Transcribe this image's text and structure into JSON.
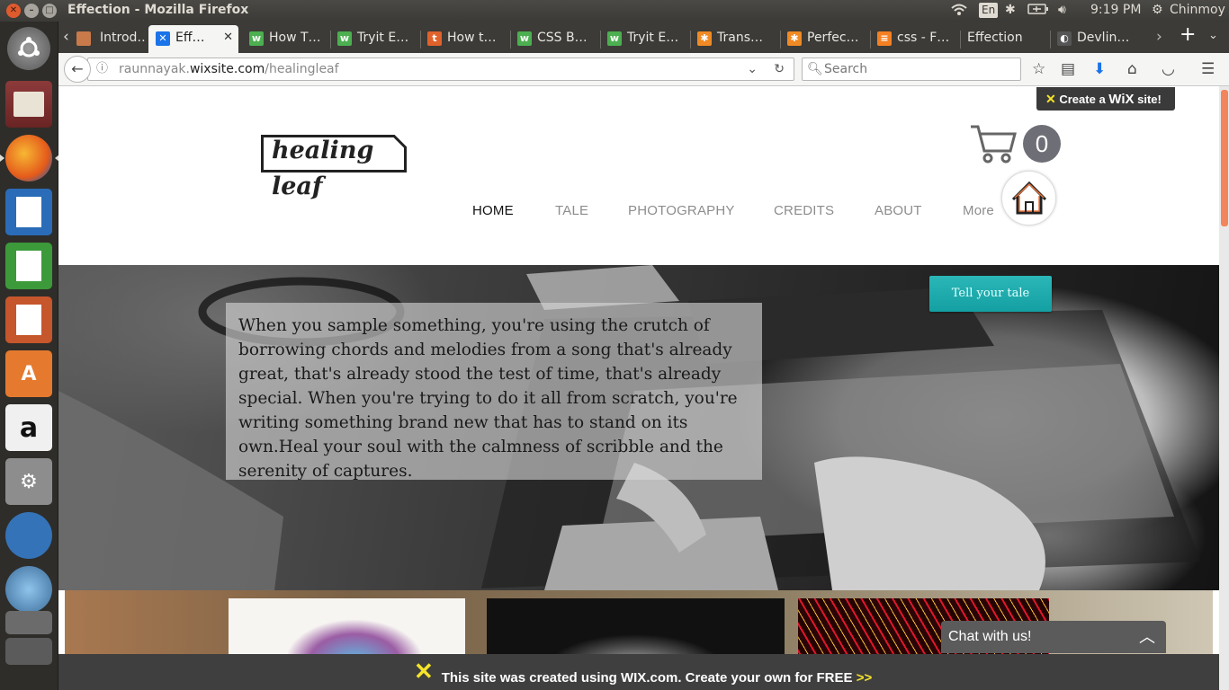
{
  "os": {
    "window_title": "Effection - Mozilla Firefox",
    "tray": {
      "keyboard": "En",
      "time": "9:19 PM",
      "user": "Chinmoy"
    }
  },
  "launcher": {
    "items": [
      "ubuntu-dash",
      "files",
      "firefox",
      "writer",
      "calc",
      "impress",
      "software-center",
      "amazon",
      "system-settings",
      "app-fish",
      "app-spiral",
      "workspaces",
      "trash"
    ]
  },
  "browser": {
    "tabs": [
      {
        "label": "Introd…",
        "icon": "doc"
      },
      {
        "label": "Eff…",
        "icon": "wix",
        "active": true
      },
      {
        "label": "How T…",
        "icon": "w3"
      },
      {
        "label": "Tryit E…",
        "icon": "w3"
      },
      {
        "label": "How t…",
        "icon": "t"
      },
      {
        "label": "CSS B…",
        "icon": "w3"
      },
      {
        "label": "Tryit E…",
        "icon": "w3"
      },
      {
        "label": "Trans…",
        "icon": "star"
      },
      {
        "label": "Perfec…",
        "icon": "star"
      },
      {
        "label": "css - F…",
        "icon": "so"
      },
      {
        "label": "Effection",
        "icon": "none"
      },
      {
        "label": "Devlin…",
        "icon": "dev"
      }
    ],
    "url_domain_prefix": "raunnayak.",
    "url_domain": "wixsite.com",
    "url_path": "/healingleaf",
    "search_placeholder": "Search"
  },
  "site": {
    "logo_line1": "healing",
    "logo_line2": "leaf",
    "cart_count": "0",
    "menu": [
      "HOME",
      "TALE",
      "PHOTOGRAPHY",
      "CREDITS",
      "ABOUT",
      "More"
    ],
    "active_menu": "HOME",
    "quote": "When you sample something, you're using the crutch of borrowing chords and melodies from a song that's already great, that's already stood the test of time, that's already special. When you're trying to do it all from scratch, you're writing something brand new that has to stand on its own.Heal your soul with the calmness of scribble and the serenity of captures.",
    "tale_button": "Tell your tale",
    "wix_badge_pre": "Create a",
    "wix_badge_brand": "WiX",
    "wix_badge_post": "site!",
    "chat_label": "Chat with us!",
    "wix_bar_text": "This site was created using WIX.com. Create your own for FREE",
    "wix_bar_arrow": ">>"
  },
  "colors": {
    "accent_teal": "#1aa9aa",
    "scroll_orange": "#f2855c",
    "wix_yellow": "#f6e42a"
  }
}
